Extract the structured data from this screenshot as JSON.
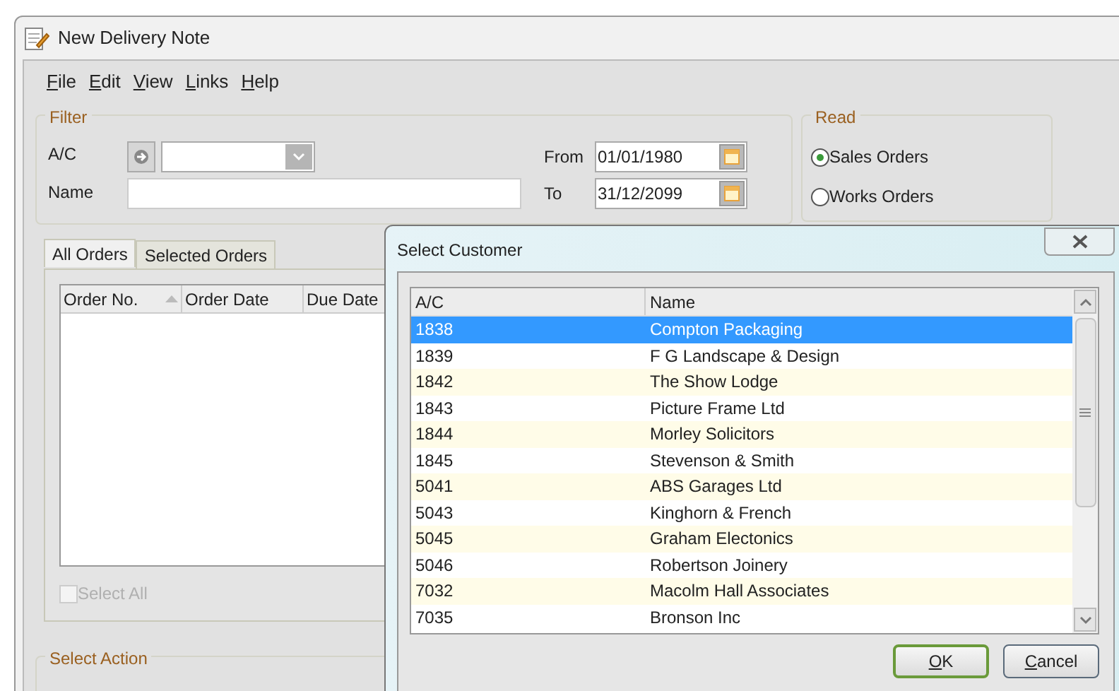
{
  "window": {
    "title": "New Delivery Note"
  },
  "menu": [
    {
      "label": "File"
    },
    {
      "label": "Edit"
    },
    {
      "label": "View"
    },
    {
      "label": "Links"
    },
    {
      "label": "Help"
    }
  ],
  "filter": {
    "title": "Filter",
    "ac_label": "A/C",
    "name_label": "Name",
    "from_label": "From",
    "from_value": "01/01/1980",
    "to_label": "To",
    "to_value": "31/12/2099"
  },
  "read": {
    "title": "Read",
    "options": [
      {
        "label": "Sales Orders",
        "selected": true
      },
      {
        "label": "Works Orders",
        "selected": false
      }
    ]
  },
  "tabs": [
    {
      "label": "All Orders",
      "selected": true
    },
    {
      "label": "Selected Orders",
      "selected": false
    }
  ],
  "orders": {
    "columns": [
      "Order No.",
      "Order Date",
      "Due Date"
    ]
  },
  "select_all": {
    "label": "Select All",
    "checked": false,
    "disabled": true
  },
  "select_action": {
    "title": "Select Action"
  },
  "dialog": {
    "title": "Select Customer",
    "columns": [
      "A/C",
      "Name"
    ],
    "rows": [
      {
        "ac": "1838",
        "name": "Compton Packaging",
        "selected": true
      },
      {
        "ac": "1839",
        "name": "F G Landscape & Design",
        "selected": false
      },
      {
        "ac": "1842",
        "name": "The Show Lodge",
        "selected": false
      },
      {
        "ac": "1843",
        "name": "Picture Frame Ltd",
        "selected": false
      },
      {
        "ac": "1844",
        "name": "Morley Solicitors",
        "selected": false
      },
      {
        "ac": "1845",
        "name": "Stevenson & Smith",
        "selected": false
      },
      {
        "ac": "5041",
        "name": "ABS Garages Ltd",
        "selected": false
      },
      {
        "ac": "5043",
        "name": "Kinghorn & French",
        "selected": false
      },
      {
        "ac": "5045",
        "name": "Graham Electonics",
        "selected": false
      },
      {
        "ac": "5046",
        "name": "Robertson Joinery",
        "selected": false
      },
      {
        "ac": "7032",
        "name": "Macolm Hall Associates",
        "selected": false
      },
      {
        "ac": "7035",
        "name": "Bronson Inc",
        "selected": false
      }
    ],
    "buttons": [
      {
        "label": "OK",
        "kind": "default"
      },
      {
        "label": "Cancel",
        "kind": "normal"
      }
    ]
  }
}
